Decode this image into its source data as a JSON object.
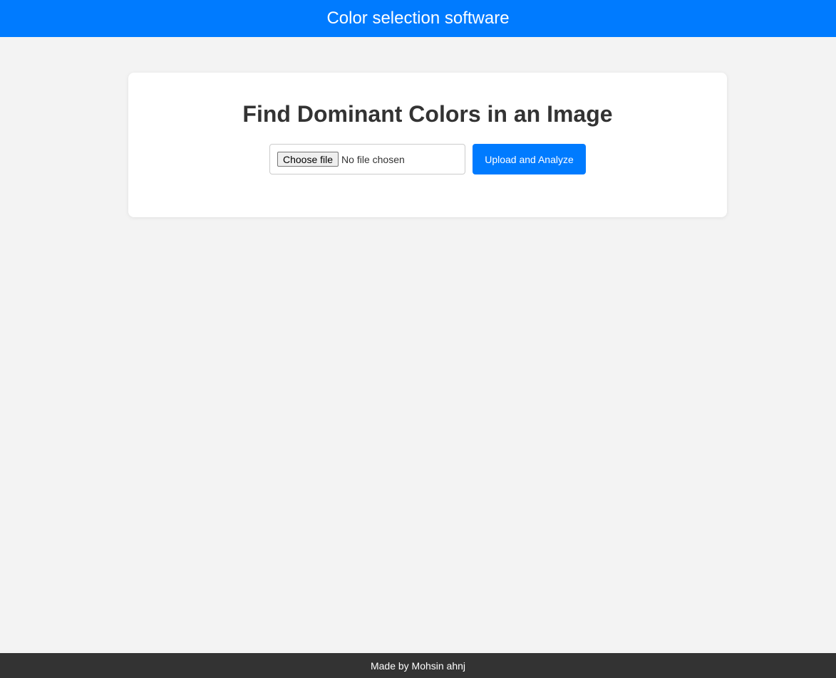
{
  "header": {
    "title": "Color selection software"
  },
  "main": {
    "heading": "Find Dominant Colors in an Image",
    "file_input": {
      "button_label": "Choose file",
      "status": "No file chosen"
    },
    "upload_button_label": "Upload and Analyze"
  },
  "footer": {
    "text": "Made by Mohsin ahnj"
  },
  "colors": {
    "accent": "#007bff",
    "page_background": "#f3f3f3",
    "card_background": "#ffffff",
    "footer_background": "#333333",
    "heading_text": "#333333"
  }
}
